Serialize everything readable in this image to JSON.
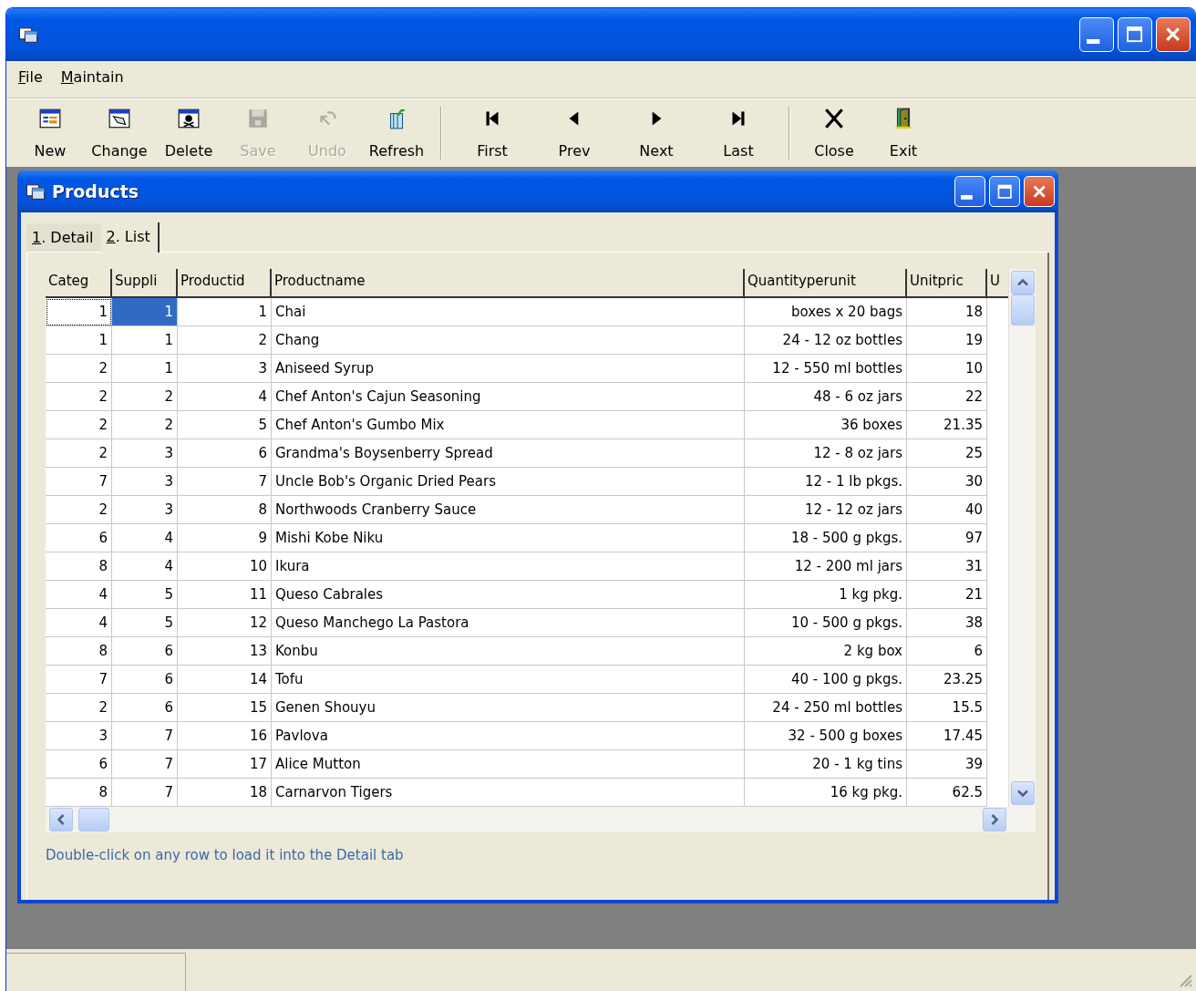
{
  "menu": [
    {
      "label": "File"
    },
    {
      "label": "Maintain"
    }
  ],
  "toolbar": [
    [
      {
        "label": "New",
        "disabled": false
      },
      {
        "label": "Change",
        "disabled": false
      },
      {
        "label": "Delete",
        "disabled": false
      },
      {
        "label": "Save",
        "disabled": true
      },
      {
        "label": "Undo",
        "disabled": true
      },
      {
        "label": "Refresh",
        "disabled": false
      }
    ],
    [
      {
        "label": "First",
        "disabled": false
      },
      {
        "label": "Prev",
        "disabled": false
      },
      {
        "label": "Next",
        "disabled": false
      },
      {
        "label": "Last",
        "disabled": false
      }
    ],
    [
      {
        "label": "Close",
        "disabled": false
      },
      {
        "label": "Exit",
        "disabled": false
      }
    ]
  ],
  "child_window": {
    "title": "Products",
    "tabs": [
      {
        "label": "1. Detail",
        "selected": false
      },
      {
        "label": "2. List",
        "selected": true
      }
    ],
    "table": {
      "columns": [
        "Categ",
        "Suppli",
        "Productid",
        "Productname",
        "Quantityperunit",
        "Unitpric",
        "U"
      ],
      "rows": [
        {
          "selected": true,
          "cells": [
            "1",
            "1",
            "1",
            "Chai",
            "boxes x 20 bags",
            "18"
          ]
        },
        {
          "selected": false,
          "cells": [
            "1",
            "1",
            "2",
            "Chang",
            "24 - 12 oz bottles",
            "19"
          ]
        },
        {
          "selected": false,
          "cells": [
            "2",
            "1",
            "3",
            "Aniseed Syrup",
            "12 - 550 ml bottles",
            "10"
          ]
        },
        {
          "selected": false,
          "cells": [
            "2",
            "2",
            "4",
            "Chef Anton's Cajun Seasoning",
            "48 - 6 oz jars",
            "22"
          ]
        },
        {
          "selected": false,
          "cells": [
            "2",
            "2",
            "5",
            "Chef Anton's Gumbo Mix",
            "36 boxes",
            "21.35"
          ]
        },
        {
          "selected": false,
          "cells": [
            "2",
            "3",
            "6",
            "Grandma's Boysenberry Spread",
            "12 - 8 oz jars",
            "25"
          ]
        },
        {
          "selected": false,
          "cells": [
            "7",
            "3",
            "7",
            "Uncle Bob's Organic Dried Pears",
            "12 - 1 lb pkgs.",
            "30"
          ]
        },
        {
          "selected": false,
          "cells": [
            "2",
            "3",
            "8",
            "Northwoods Cranberry Sauce",
            "12 - 12 oz jars",
            "40"
          ]
        },
        {
          "selected": false,
          "cells": [
            "6",
            "4",
            "9",
            "Mishi Kobe Niku",
            "18 - 500 g pkgs.",
            "97"
          ]
        },
        {
          "selected": false,
          "cells": [
            "8",
            "4",
            "10",
            "Ikura",
            "12 - 200 ml jars",
            "31"
          ]
        },
        {
          "selected": false,
          "cells": [
            "4",
            "5",
            "11",
            "Queso Cabrales",
            "1 kg pkg.",
            "21"
          ]
        },
        {
          "selected": false,
          "cells": [
            "4",
            "5",
            "12",
            "Queso Manchego La Pastora",
            "10 - 500 g pkgs.",
            "38"
          ]
        },
        {
          "selected": false,
          "cells": [
            "8",
            "6",
            "13",
            "Konbu",
            "2 kg box",
            "6"
          ]
        },
        {
          "selected": false,
          "cells": [
            "7",
            "6",
            "14",
            "Tofu",
            "40 - 100 g pkgs.",
            "23.25"
          ]
        },
        {
          "selected": false,
          "cells": [
            "2",
            "6",
            "15",
            "Genen Shouyu",
            "24 - 250 ml bottles",
            "15.5"
          ]
        },
        {
          "selected": false,
          "cells": [
            "3",
            "7",
            "16",
            "Pavlova",
            "32 - 500 g boxes",
            "17.45"
          ]
        },
        {
          "selected": false,
          "cells": [
            "6",
            "7",
            "17",
            "Alice Mutton",
            "20 - 1 kg tins",
            "39"
          ]
        },
        {
          "selected": false,
          "cells": [
            "8",
            "7",
            "18",
            "Carnarvon Tigers",
            "16 kg pkg.",
            "62.5"
          ]
        }
      ]
    },
    "hint": "Double-click on any row to load it into the Detail tab"
  }
}
